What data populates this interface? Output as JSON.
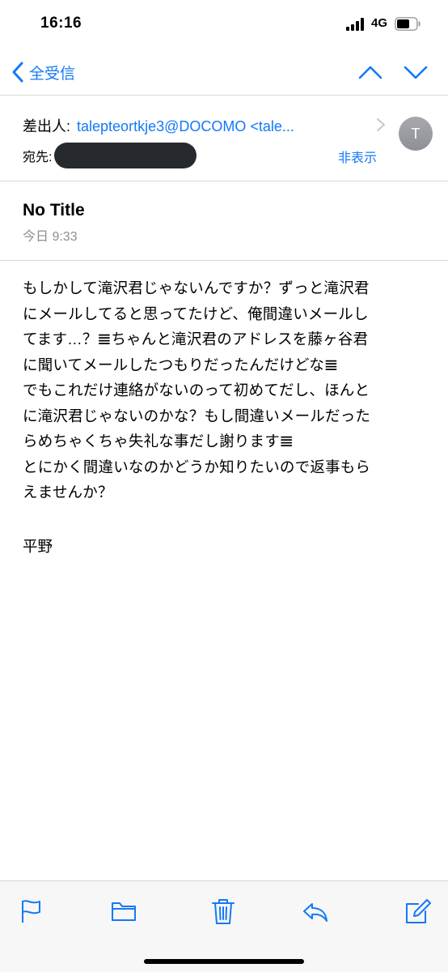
{
  "status_bar": {
    "time": "16:16",
    "network": "4G"
  },
  "nav": {
    "back_label": "全受信"
  },
  "header": {
    "from_label": "差出人:",
    "from_value": "talepteortkje3@DOCOMO <tale...",
    "to_label": "宛先:",
    "hide_label": "非表示",
    "avatar_initial": "T"
  },
  "message": {
    "subject": "No Title",
    "date": "今日 9:33",
    "body_lines": [
      "もしかして滝沢君じゃないんですか？ずっと滝沢君",
      "にメールしてると思ってたけど、俺間違いメールし",
      "てます…？𝌆ちゃんと滝沢君のアドレスを藤ヶ谷君",
      "に聞いてメールしたつもりだったんだけどな𝌆",
      "でもこれだけ連絡がないのって初めてだし、ほんと",
      "に滝沢君じゃないのかな？もし間違いメールだった",
      "らめちゃくちゃ失礼な事だし謝ります𝌆",
      "とにかく間違いなのかどうか知りたいので返事もら",
      "えませんか？"
    ],
    "signature": "平野"
  },
  "colors": {
    "accent": "#1479f5",
    "secondary_text": "#8e8e93",
    "redaction": "#26292d"
  }
}
